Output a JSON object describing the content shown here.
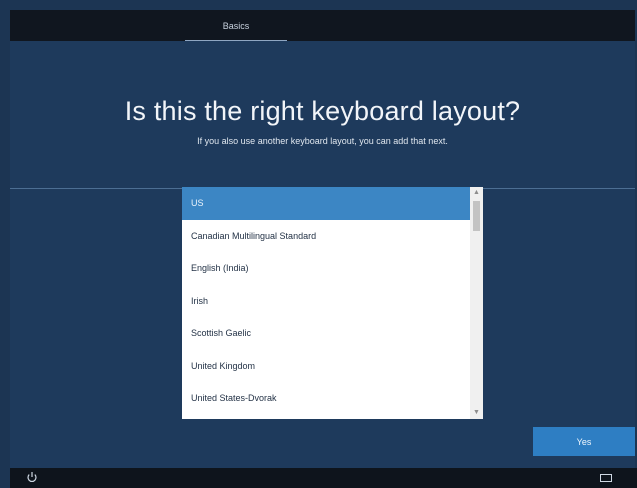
{
  "header": {
    "tab_label": "Basics"
  },
  "main": {
    "title": "Is this the right keyboard layout?",
    "subtitle": "If you also use another keyboard layout, you can add that next.",
    "layouts": [
      "US",
      "Canadian Multilingual Standard",
      "English (India)",
      "Irish",
      "Scottish Gaelic",
      "United Kingdom",
      "United States-Dvorak"
    ],
    "selected_layout": "US"
  },
  "footer": {
    "yes_label": "Yes",
    "icons": [
      "accessibility-icon",
      "keyboard-icon"
    ]
  },
  "colors": {
    "background": "#1e3a5c",
    "accent": "#2e7ec3",
    "selection": "#3c86c4",
    "topbar": "#10161f"
  }
}
